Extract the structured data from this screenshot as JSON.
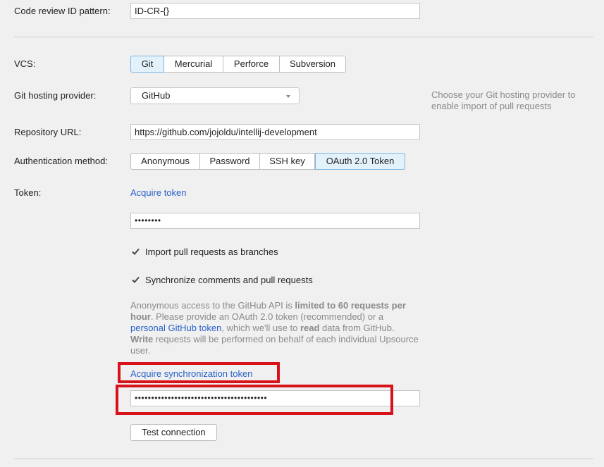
{
  "code_review": {
    "label": "Code review ID pattern:",
    "value": "ID-CR-{}"
  },
  "vcs": {
    "label": "VCS:",
    "options": [
      "Git",
      "Mercurial",
      "Perforce",
      "Subversion"
    ],
    "selected": "Git"
  },
  "hosting": {
    "label": "Git hosting provider:",
    "value": "GitHub",
    "hint": "Choose your Git hosting provider to enable import of pull requests"
  },
  "repo": {
    "label": "Repository URL:",
    "value": "https://github.com/jojoldu/intellij-development"
  },
  "auth": {
    "label": "Authentication method:",
    "options": [
      "Anonymous",
      "Password",
      "SSH key",
      "OAuth 2.0 Token"
    ],
    "selected": "OAuth 2.0 Token"
  },
  "token": {
    "label": "Token:",
    "acquire_link": "Acquire token",
    "value": "••••••••"
  },
  "checkboxes": {
    "import_prs": {
      "label": "Import pull requests as branches",
      "checked": true
    },
    "sync_comments": {
      "label": "Synchronize comments and pull requests",
      "checked": true
    }
  },
  "info": {
    "part1": "Anonymous access to the GitHub API is ",
    "bold1": "limited to 60 requests per hour",
    "part2": ". Please provide an OAuth 2.0 token (recommended) or a ",
    "link": "personal GitHub token",
    "part3": ", which we'll use to ",
    "bold2": "read",
    "part4": " data from GitHub. ",
    "bold3": "Write",
    "part5": " requests will be performed on behalf of each individual Upsource user."
  },
  "sync_token": {
    "acquire_link": "Acquire synchronization token",
    "value": "••••••••••••••••••••••••••••••••••••••••"
  },
  "test_button": "Test connection",
  "colors": {
    "background": "#f0f0f0",
    "link": "#2a62c9",
    "highlight": "#d8121a",
    "active_segment": "#e3f1fb",
    "hint": "#8a8a8a"
  }
}
